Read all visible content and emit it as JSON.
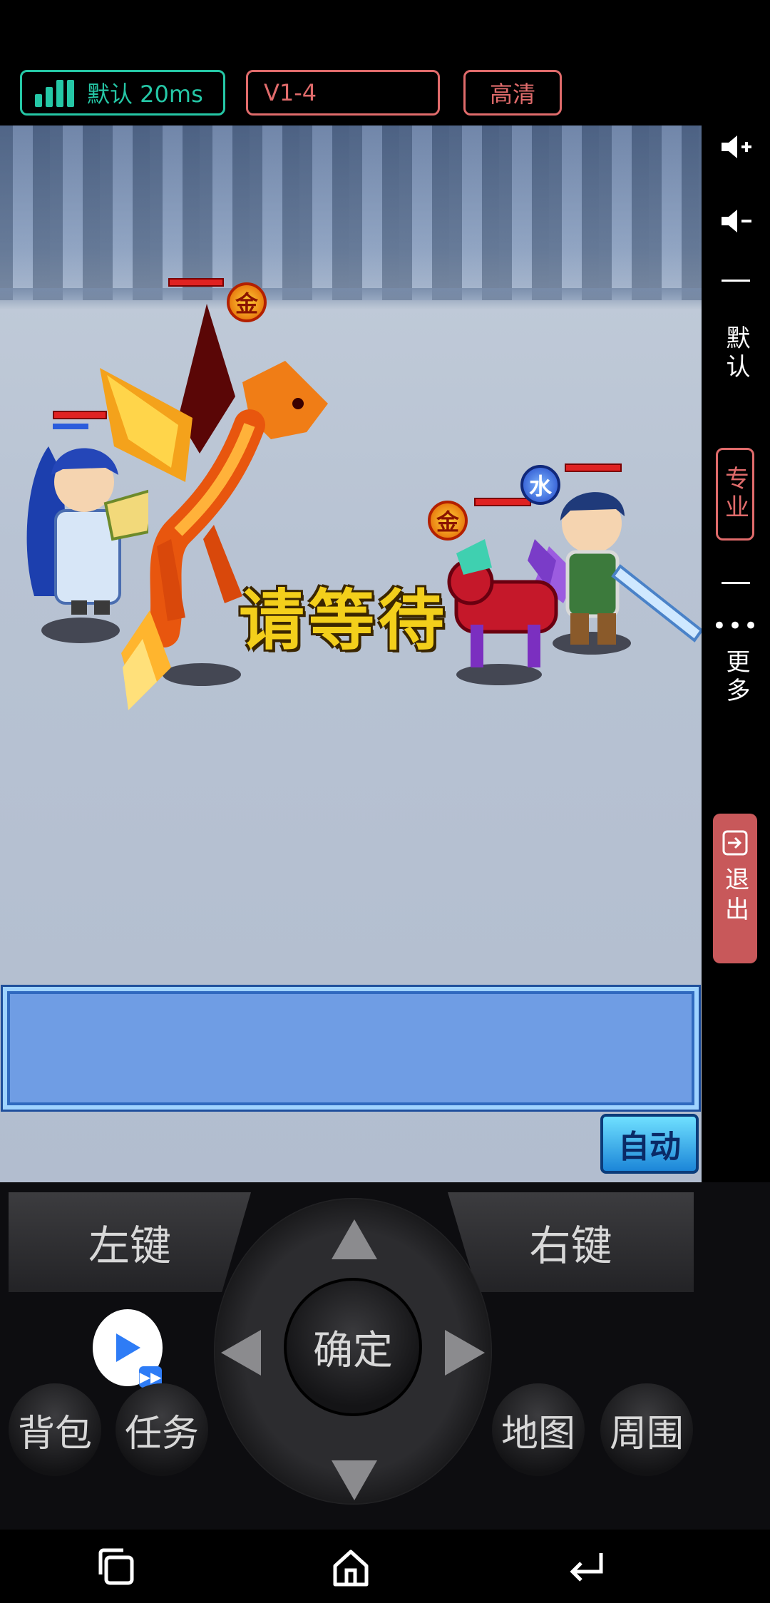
{
  "status_bar": {
    "network_label": "默认 20ms",
    "version_label": "V1-4",
    "quality_label": "高清"
  },
  "game": {
    "wait_text": "请等待",
    "elements": {
      "dragon": "金",
      "enemy_mount": "金",
      "enemy_hero": "水"
    },
    "auto_label": "自动",
    "colors": {
      "wait_text": "#f3cf1b",
      "message_box": "#6f9de4",
      "hp": "#e02222"
    }
  },
  "side_panel": {
    "volume_up_icon": "speaker-plus-icon",
    "volume_down_icon": "speaker-minus-icon",
    "default_label": "默认",
    "pro_label": "专业",
    "more_label": "更多",
    "exit_label": "退出",
    "exit_color": "#c8585a"
  },
  "controller": {
    "left_key": "左键",
    "right_key": "右键",
    "confirm": "确定",
    "bag": "背包",
    "task": "任务",
    "map": "地图",
    "nearby": "周围"
  },
  "accent": {
    "network": "#25c7a6",
    "red_outline": "#e06b6b"
  }
}
